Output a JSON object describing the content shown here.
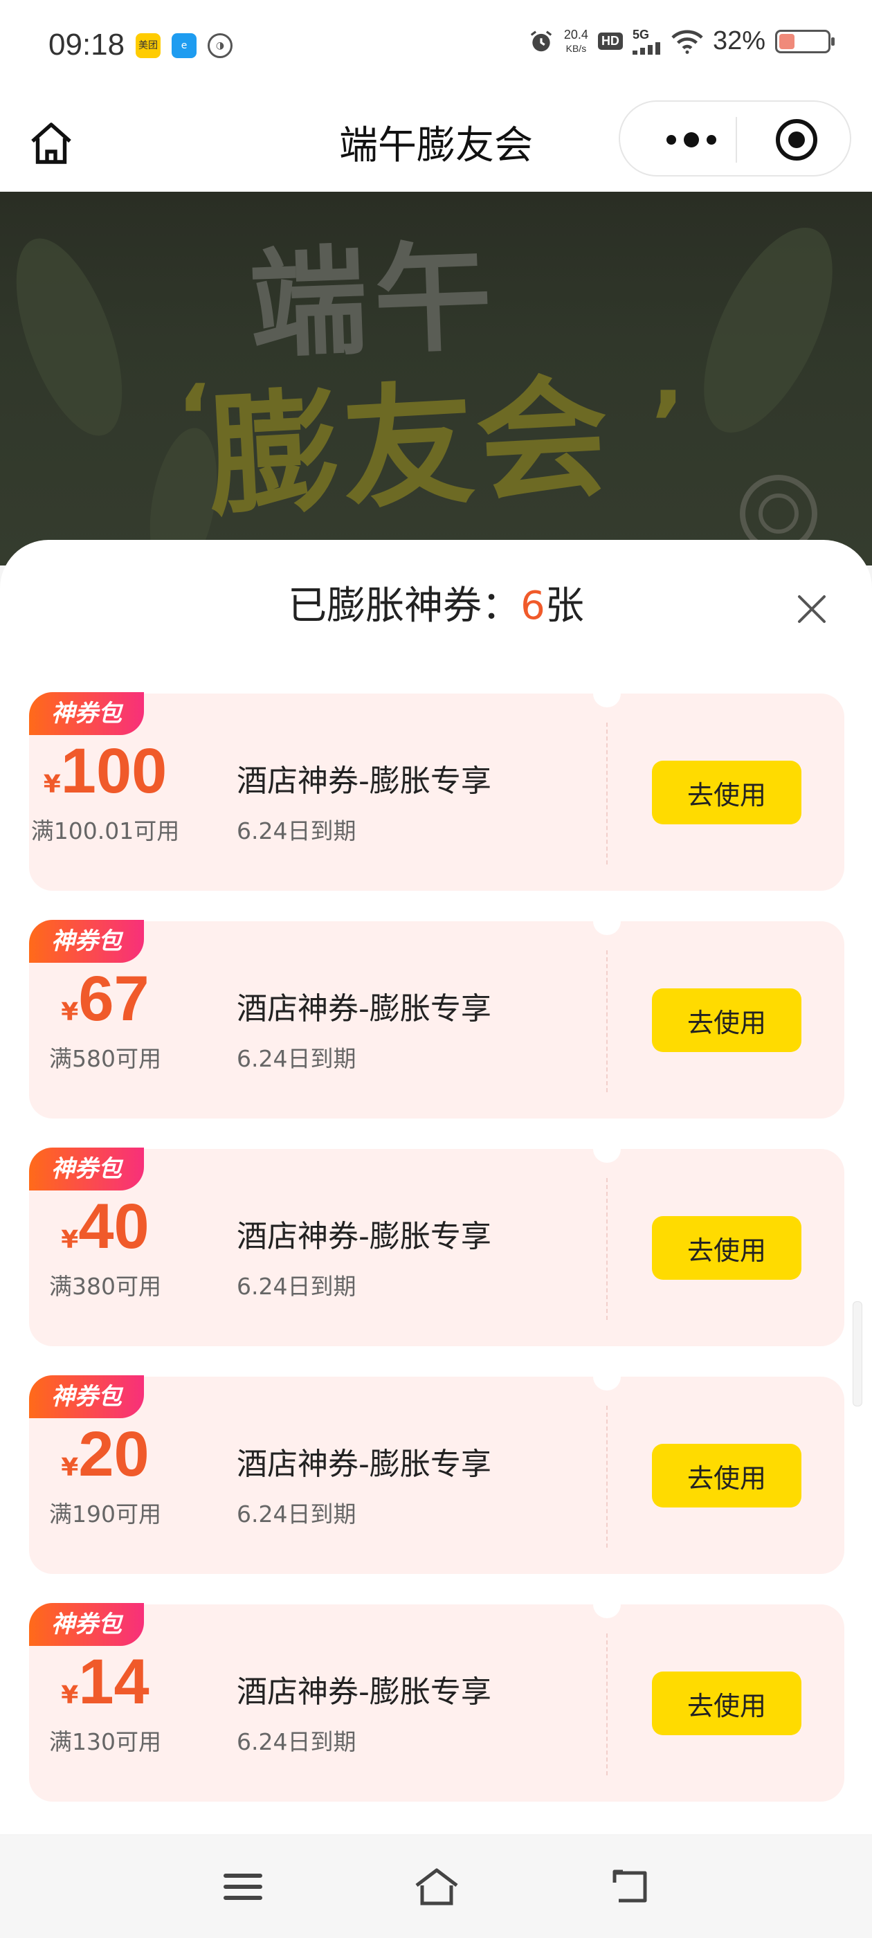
{
  "status_bar": {
    "time": "09:18",
    "net_speed_value": "20.4",
    "net_speed_unit": "KB/s",
    "hd": "HD",
    "signal": "5G",
    "battery": "32%",
    "battery_level": 0.32,
    "app_icons": [
      "meituan-app-icon",
      "browser-app-icon",
      "pill-app-icon"
    ]
  },
  "nav": {
    "title": "端午膨友会"
  },
  "banner": {
    "line1": "端午",
    "line2": "膨友会",
    "quote_open": "‘",
    "quote_close": "’"
  },
  "sheet": {
    "title_prefix": "已膨胀神券：",
    "count": "6",
    "title_suffix": "张"
  },
  "coupons": [
    {
      "tag": "神券包",
      "currency": "¥",
      "amount": "100",
      "condition": "满100.01可用",
      "name": "酒店神券-膨胀专享",
      "expiry": "6.24日到期",
      "button": "去使用"
    },
    {
      "tag": "神券包",
      "currency": "¥",
      "amount": "67",
      "condition": "满580可用",
      "name": "酒店神券-膨胀专享",
      "expiry": "6.24日到期",
      "button": "去使用"
    },
    {
      "tag": "神券包",
      "currency": "¥",
      "amount": "40",
      "condition": "满380可用",
      "name": "酒店神券-膨胀专享",
      "expiry": "6.24日到期",
      "button": "去使用"
    },
    {
      "tag": "神券包",
      "currency": "¥",
      "amount": "20",
      "condition": "满190可用",
      "name": "酒店神券-膨胀专享",
      "expiry": "6.24日到期",
      "button": "去使用"
    },
    {
      "tag": "神券包",
      "currency": "¥",
      "amount": "14",
      "condition": "满130可用",
      "name": "酒店神券-膨胀专享",
      "expiry": "6.24日到期",
      "button": "去使用"
    }
  ],
  "colors": {
    "accent": "#f05a2a",
    "button": "#ffdb00",
    "coupon_bg": "#fff0ee",
    "tag_gradient": [
      "#ff6a1a",
      "#f8307a"
    ]
  }
}
